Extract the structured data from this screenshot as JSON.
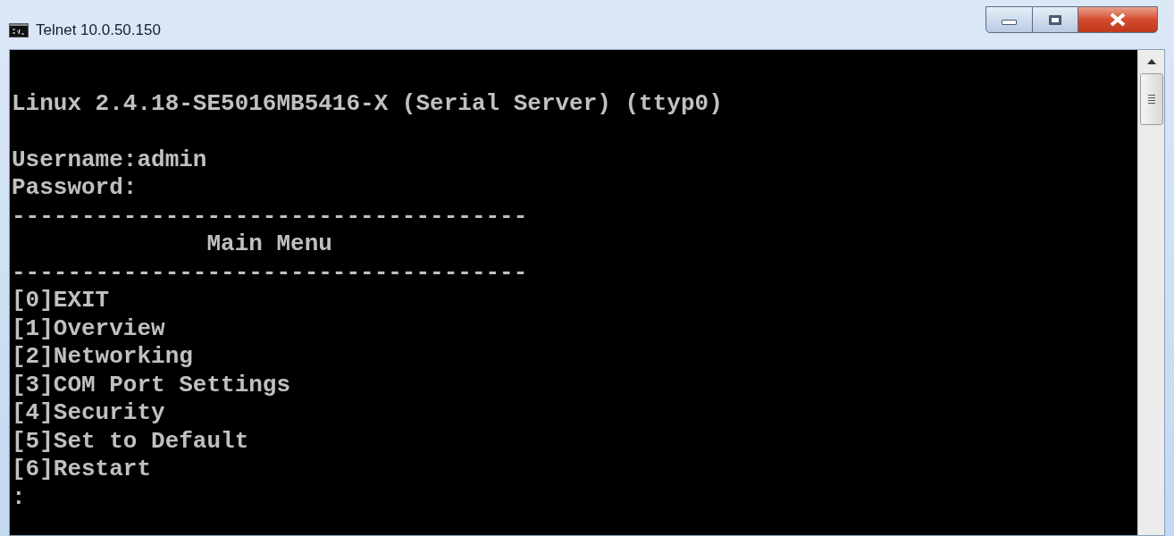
{
  "window": {
    "title": "Telnet 10.0.50.150"
  },
  "terminal": {
    "lines": [
      {
        "kind": "text",
        "text": "Linux 2.4.18-SE5016MB5416-X (Serial Server) (ttyp0)"
      },
      {
        "kind": "blank"
      },
      {
        "kind": "text",
        "text": "Username:admin"
      },
      {
        "kind": "text",
        "text": "Password:"
      },
      {
        "kind": "text",
        "text": "-------------------------------------"
      },
      {
        "kind": "text",
        "text": "              Main Menu"
      },
      {
        "kind": "text",
        "text": "-------------------------------------"
      },
      {
        "kind": "text",
        "text": "[0]EXIT"
      },
      {
        "kind": "text",
        "text": "[1]Overview"
      },
      {
        "kind": "text",
        "text": "[2]Networking"
      },
      {
        "kind": "text",
        "text": "[3]COM Port Settings"
      },
      {
        "kind": "text",
        "text": "[4]Security"
      },
      {
        "kind": "text",
        "text": "[5]Set to Default"
      },
      {
        "kind": "text",
        "text": "[6]Restart"
      },
      {
        "kind": "text",
        "text": ":"
      }
    ]
  }
}
